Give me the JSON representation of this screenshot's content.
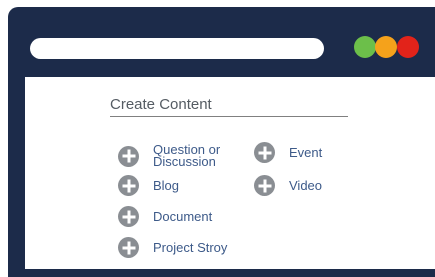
{
  "window": {
    "colors": {
      "frame": "#1c2b4a",
      "dot_green": "#6cbf4a",
      "dot_yellow": "#f5a21b",
      "dot_red": "#e2231a"
    }
  },
  "panel": {
    "title": "Create Content",
    "left_items": [
      {
        "lines": [
          "Question or",
          "Discussion"
        ],
        "icon": "plus-circle-icon"
      },
      {
        "label": "Blog",
        "icon": "plus-circle-icon"
      },
      {
        "label": "Document",
        "icon": "plus-circle-icon"
      },
      {
        "label": "Project Stroy",
        "icon": "plus-circle-icon"
      }
    ],
    "right_items": [
      {
        "label": "Event",
        "icon": "plus-circle-icon"
      },
      {
        "label": "Video",
        "icon": "plus-circle-icon"
      }
    ]
  }
}
